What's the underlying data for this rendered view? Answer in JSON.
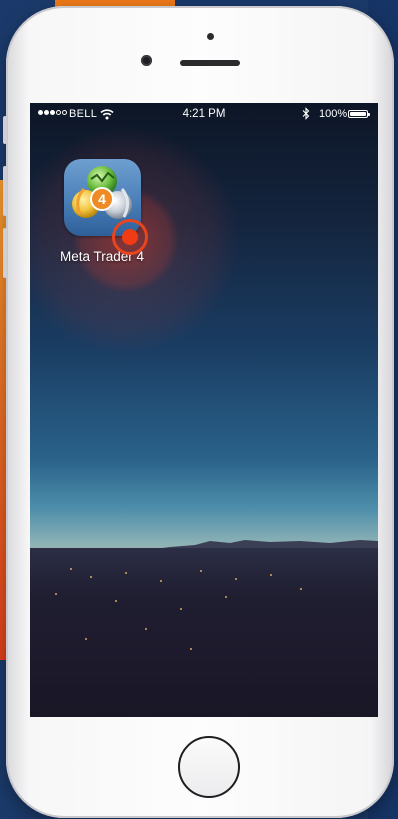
{
  "status_bar": {
    "carrier": "BELL",
    "time": "4:21 PM",
    "battery_percent": "100%",
    "signal_bars_filled": 3,
    "signal_bars_total": 5,
    "icons": [
      "signal-dots-icon",
      "wifi-icon",
      "bluetooth-icon",
      "battery-icon"
    ]
  },
  "home_screen": {
    "apps": [
      {
        "label": "Meta Trader 4",
        "icon": "metatrader-4-icon",
        "badge_number": "4",
        "state": "tapped"
      }
    ]
  },
  "tap_indicator": {
    "icon": "tap-marker-icon",
    "color": "#ef3c14"
  },
  "colors": {
    "background_blue": "#1b3a6b",
    "background_orange": "#f07a1a",
    "phone_body": "#f7f7f8"
  }
}
